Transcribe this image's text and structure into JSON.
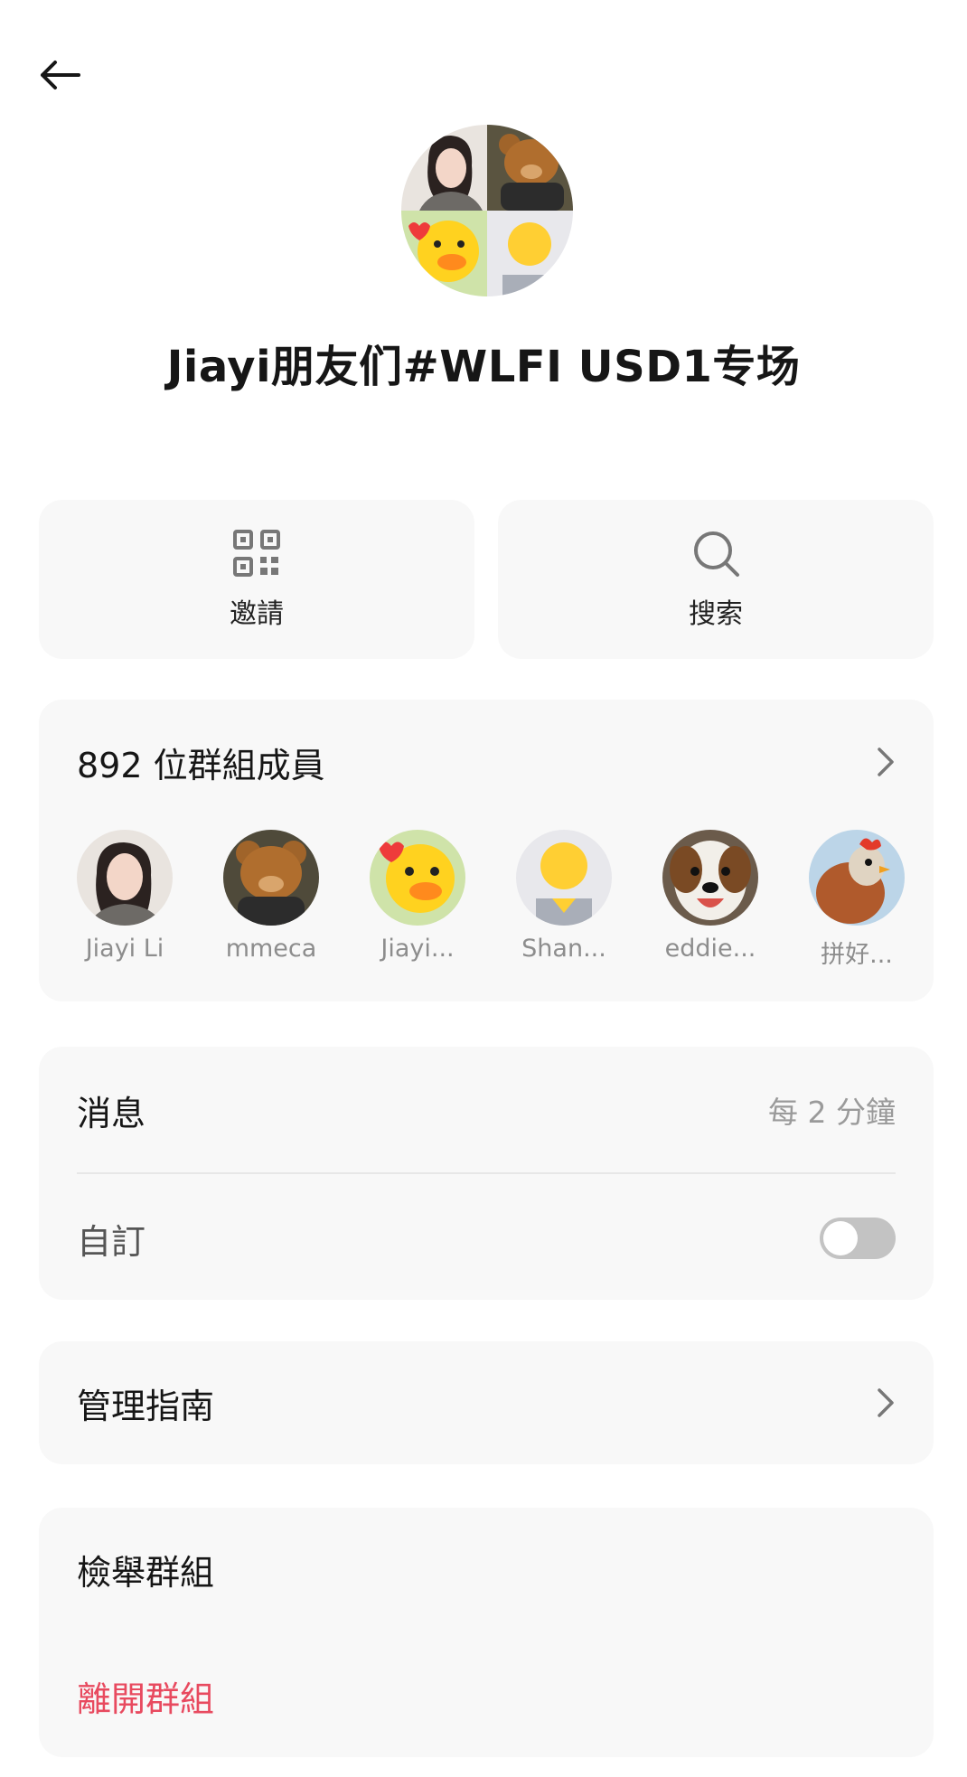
{
  "header": {
    "back_icon": "arrow-left-icon"
  },
  "group": {
    "title": "Jiayi朋友们#WLFI USD1专场"
  },
  "actions": [
    {
      "label": "邀請",
      "icon": "qr-code-icon"
    },
    {
      "label": "搜索",
      "icon": "search-icon"
    }
  ],
  "members": {
    "title": "892 位群組成員",
    "list": [
      {
        "name": "Jiayi Li"
      },
      {
        "name": "mmeca"
      },
      {
        "name": "Jiayi..."
      },
      {
        "name": "Shan..."
      },
      {
        "name": "eddie..."
      },
      {
        "name": "拼好..."
      }
    ]
  },
  "settings": {
    "messages_label": "消息",
    "messages_value": "每 2 分鐘",
    "custom_label": "自訂",
    "custom_enabled": false
  },
  "guide": {
    "label": "管理指南"
  },
  "report": {
    "label": "檢舉群組"
  },
  "leave": {
    "label": "離開群組"
  },
  "colors": {
    "danger": "#e84a5f",
    "card_bg": "#f8f8f8",
    "toggle_off": "#c3c3c3"
  }
}
